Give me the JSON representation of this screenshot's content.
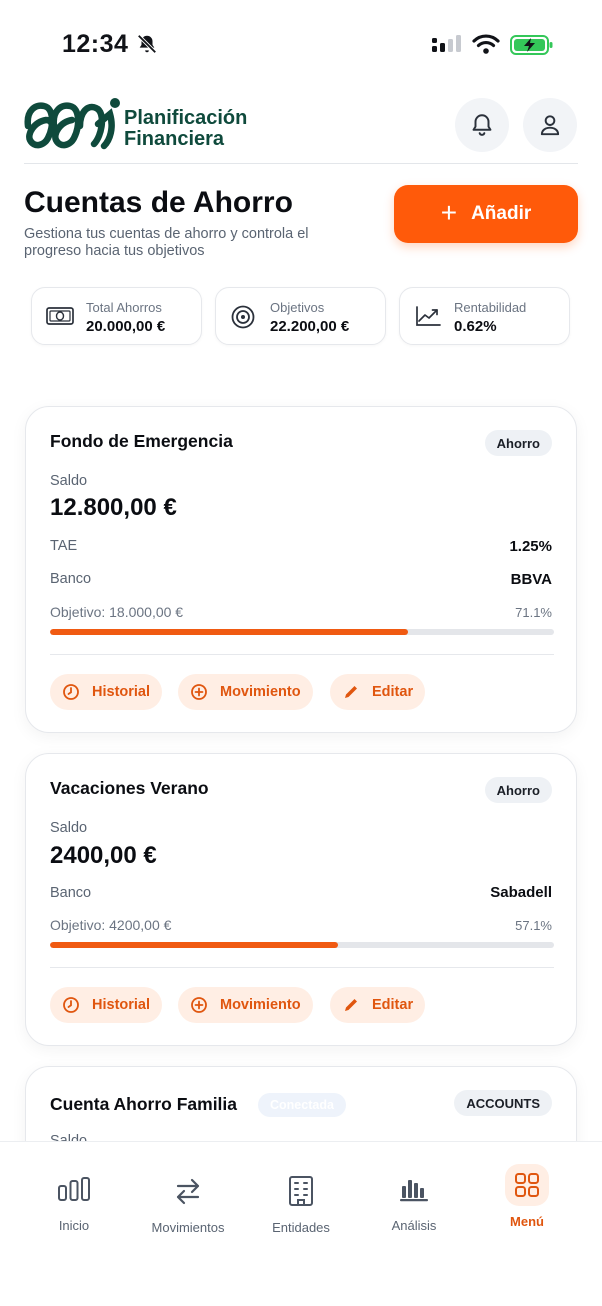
{
  "status_bar": {
    "time": "12:34"
  },
  "brand": {
    "line1": "Planificación",
    "line2": "Financiera",
    "primary_color": "#0f4a3c"
  },
  "page": {
    "title": "Cuentas de Ahorro",
    "subtitle": "Gestiona tus cuentas de ahorro y controla el progreso hacia tus objetivos",
    "add_label": "Añadir",
    "accent_color": "#ff5a0a"
  },
  "stats": [
    {
      "label": "Total Ahorros",
      "value": "20.000,00 €",
      "icon": "money-icon"
    },
    {
      "label": "Objetivos",
      "value": "22.200,00 €",
      "icon": "target-icon"
    },
    {
      "label": "Rentabilidad",
      "value": "0.62%",
      "icon": "trend-icon"
    }
  ],
  "accounts": [
    {
      "name": "Fondo de Emergencia",
      "badge": "Ahorro",
      "balance_label": "Saldo",
      "balance": "12.800,00 €",
      "rows": [
        {
          "label": "TAE",
          "value": "1.25%"
        },
        {
          "label": "Banco",
          "value": "BBVA"
        }
      ],
      "goal_label": "Objetivo: 18.000,00 €",
      "progress_text": "71.1%",
      "progress": 0.711,
      "actions": [
        "Historial",
        "Movimiento",
        "Editar"
      ]
    },
    {
      "name": "Vacaciones Verano",
      "badge": "Ahorro",
      "balance_label": "Saldo",
      "balance": "2400,00 €",
      "rows": [
        {
          "label": "Banco",
          "value": "Sabadell"
        }
      ],
      "goal_label": "Objetivo: 4200,00 €",
      "progress_text": "57.1%",
      "progress": 0.571,
      "actions": [
        "Historial",
        "Movimiento",
        "Editar"
      ]
    },
    {
      "name": "Cuenta Ahorro Familia",
      "status": "Conectada",
      "badge": "ACCOUNTS",
      "balance_label": "Saldo"
    }
  ],
  "nav": [
    {
      "label": "Inicio",
      "icon": "bars-icon"
    },
    {
      "label": "Movimientos",
      "icon": "transfer-icon"
    },
    {
      "label": "Entidades",
      "icon": "building-icon"
    },
    {
      "label": "Análisis",
      "icon": "analysis-icon"
    },
    {
      "label": "Menú",
      "icon": "grid-icon",
      "active": true
    }
  ]
}
